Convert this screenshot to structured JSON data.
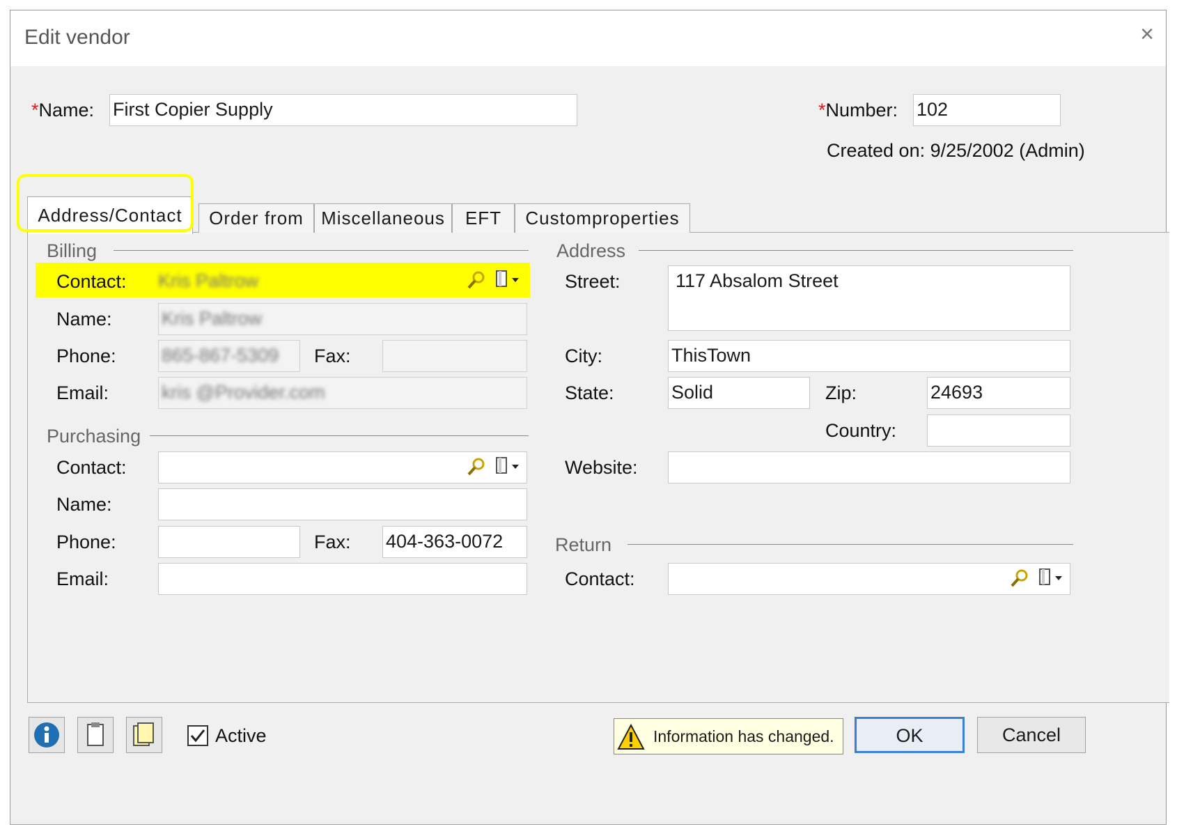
{
  "window": {
    "title": "Edit vendor"
  },
  "header": {
    "name_label": "Name:",
    "name_value": "First Copier Supply",
    "number_label": "Number:",
    "number_value": "102",
    "created": "Created on: 9/25/2002 (Admin)"
  },
  "tabs": [
    {
      "label": "Address/Contact",
      "active": true
    },
    {
      "label": "Order from"
    },
    {
      "label": "Miscellaneous"
    },
    {
      "label": "EFT"
    },
    {
      "label": "Customproperties"
    }
  ],
  "billing": {
    "title": "Billing",
    "contact_label": "Contact:",
    "contact_value": "Kris Paltrow",
    "name_label": "Name:",
    "name_value": "Kris Paltrow",
    "phone_label": "Phone:",
    "phone_value": "865-867-5309",
    "fax_label": "Fax:",
    "fax_value": "",
    "email_label": "Email:",
    "email_value": "kris @Provider.com"
  },
  "purchasing": {
    "title": "Purchasing",
    "contact_label": "Contact:",
    "name_label": "Name:",
    "phone_label": "Phone:",
    "fax_label": "Fax:",
    "fax_value": "404-363-0072",
    "email_label": "Email:"
  },
  "address": {
    "title": "Address",
    "street_label": "Street:",
    "street_value": "117 Absalom Street",
    "city_label": "City:",
    "city_value": "ThisTown",
    "state_label": "State:",
    "state_value": "Solid",
    "zip_label": "Zip:",
    "zip_value": "24693",
    "country_label": "Country:",
    "country_value": "",
    "website_label": "Website:"
  },
  "return": {
    "title": "Return",
    "contact_label": "Contact:"
  },
  "footer": {
    "active_label": "Active",
    "active_checked": true,
    "warning": "Information has changed.",
    "ok_label": "OK",
    "cancel_label": "Cancel"
  },
  "colors": {
    "highlight": "#ffff00",
    "required": "#d02020",
    "ok_border": "#3c7fd6"
  }
}
